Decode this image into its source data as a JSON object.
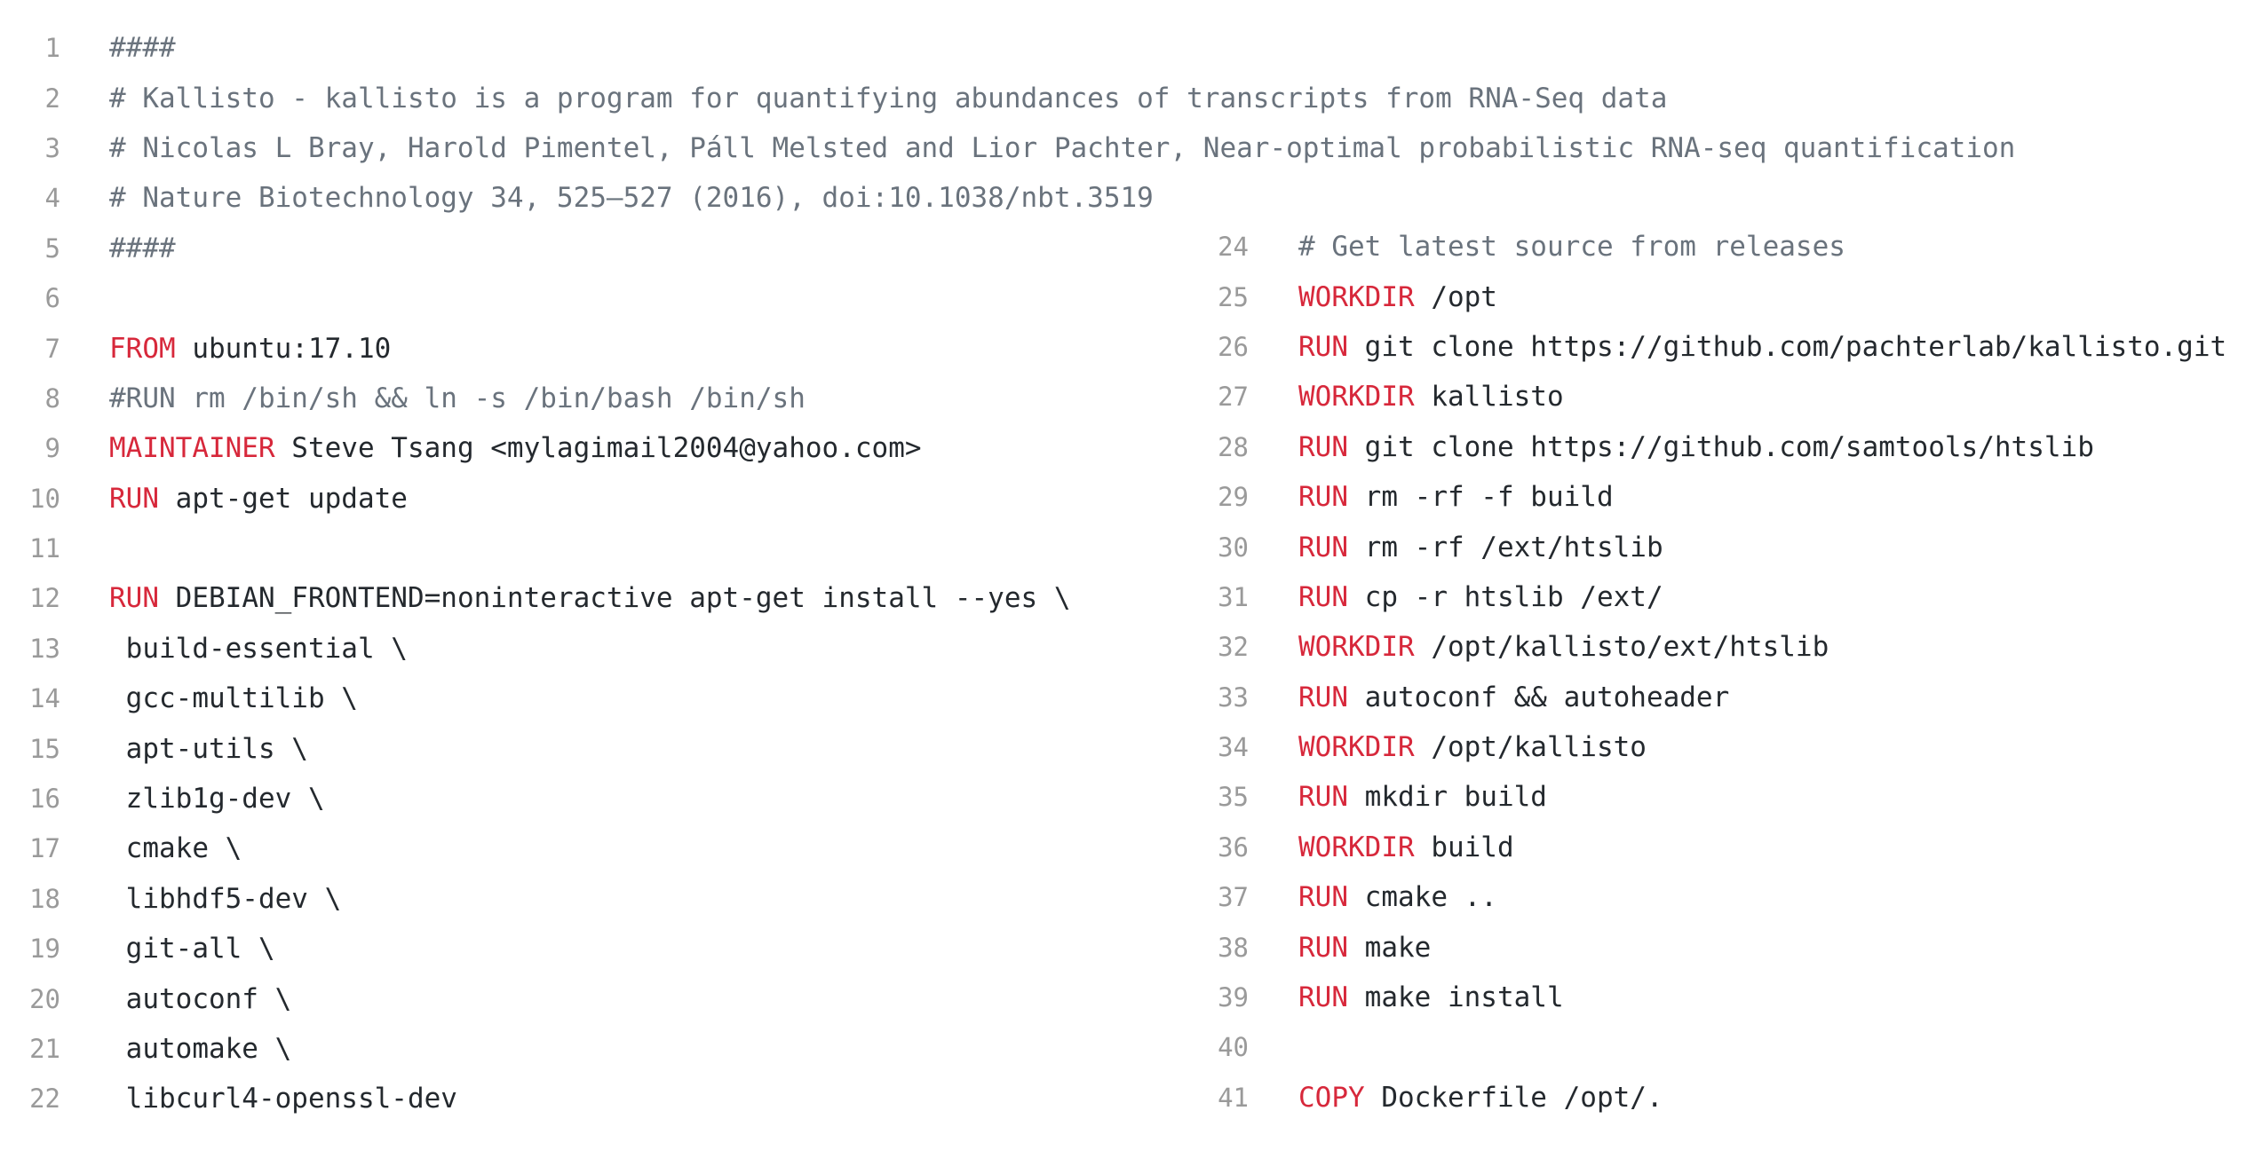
{
  "left_lines": [
    {
      "n": "1",
      "kw": "",
      "text": "####",
      "comment": true
    },
    {
      "n": "2",
      "kw": "",
      "text": "# Kallisto - kallisto is a program for quantifying abundances of transcripts from RNA-Seq data",
      "comment": true
    },
    {
      "n": "3",
      "kw": "",
      "text": "# Nicolas L Bray, Harold Pimentel, Páll Melsted and Lior Pachter, Near-optimal probabilistic RNA-seq quantification",
      "comment": true
    },
    {
      "n": "4",
      "kw": "",
      "text": "# Nature Biotechnology 34, 525–527 (2016), doi:10.1038/nbt.3519",
      "comment": true
    },
    {
      "n": "5",
      "kw": "",
      "text": "####",
      "comment": true
    },
    {
      "n": "6",
      "kw": "",
      "text": "",
      "comment": false
    },
    {
      "n": "7",
      "kw": "FROM",
      "text": " ubuntu:17.10",
      "comment": false
    },
    {
      "n": "8",
      "kw": "",
      "text": "#RUN rm /bin/sh && ln -s /bin/bash /bin/sh",
      "comment": true
    },
    {
      "n": "9",
      "kw": "MAINTAINER",
      "text": " Steve Tsang <mylagimail2004@yahoo.com>",
      "comment": false
    },
    {
      "n": "10",
      "kw": "RUN",
      "text": " apt-get update",
      "comment": false
    },
    {
      "n": "11",
      "kw": "",
      "text": "",
      "comment": false
    },
    {
      "n": "12",
      "kw": "RUN",
      "text": " DEBIAN_FRONTEND=noninteractive apt-get install --yes \\",
      "comment": false
    },
    {
      "n": "13",
      "kw": "",
      "text": " build-essential \\",
      "comment": false
    },
    {
      "n": "14",
      "kw": "",
      "text": " gcc-multilib \\",
      "comment": false
    },
    {
      "n": "15",
      "kw": "",
      "text": " apt-utils \\",
      "comment": false
    },
    {
      "n": "16",
      "kw": "",
      "text": " zlib1g-dev \\",
      "comment": false
    },
    {
      "n": "17",
      "kw": "",
      "text": " cmake \\",
      "comment": false
    },
    {
      "n": "18",
      "kw": "",
      "text": " libhdf5-dev \\",
      "comment": false
    },
    {
      "n": "19",
      "kw": "",
      "text": " git-all \\",
      "comment": false
    },
    {
      "n": "20",
      "kw": "",
      "text": " autoconf \\",
      "comment": false
    },
    {
      "n": "21",
      "kw": "",
      "text": " automake \\",
      "comment": false
    },
    {
      "n": "22",
      "kw": "",
      "text": " libcurl4-openssl-dev",
      "comment": false
    }
  ],
  "right_lines": [
    {
      "n": "24",
      "kw": "",
      "text": "# Get latest source from releases",
      "comment": true
    },
    {
      "n": "25",
      "kw": "WORKDIR",
      "text": " /opt",
      "comment": false
    },
    {
      "n": "26",
      "kw": "RUN",
      "text": " git clone https://github.com/pachterlab/kallisto.git",
      "comment": false
    },
    {
      "n": "27",
      "kw": "WORKDIR",
      "text": " kallisto",
      "comment": false
    },
    {
      "n": "28",
      "kw": "RUN",
      "text": " git clone https://github.com/samtools/htslib",
      "comment": false
    },
    {
      "n": "29",
      "kw": "RUN",
      "text": " rm -rf -f build",
      "comment": false
    },
    {
      "n": "30",
      "kw": "RUN",
      "text": " rm -rf /ext/htslib",
      "comment": false
    },
    {
      "n": "31",
      "kw": "RUN",
      "text": " cp -r htslib /ext/",
      "comment": false
    },
    {
      "n": "32",
      "kw": "WORKDIR",
      "text": " /opt/kallisto/ext/htslib",
      "comment": false
    },
    {
      "n": "33",
      "kw": "RUN",
      "text": " autoconf && autoheader",
      "comment": false
    },
    {
      "n": "34",
      "kw": "WORKDIR",
      "text": " /opt/kallisto",
      "comment": false
    },
    {
      "n": "35",
      "kw": "RUN",
      "text": " mkdir build",
      "comment": false
    },
    {
      "n": "36",
      "kw": "WORKDIR",
      "text": " build",
      "comment": false
    },
    {
      "n": "37",
      "kw": "RUN",
      "text": " cmake ..",
      "comment": false
    },
    {
      "n": "38",
      "kw": "RUN",
      "text": " make",
      "comment": false
    },
    {
      "n": "39",
      "kw": "RUN",
      "text": " make install",
      "comment": false
    },
    {
      "n": "40",
      "kw": "",
      "text": "",
      "comment": false
    },
    {
      "n": "41",
      "kw": "COPY",
      "text": " Dockerfile /opt/.",
      "comment": false
    }
  ],
  "colors": {
    "keyword": "#d7283b",
    "comment": "#6a737d",
    "text": "#24292e",
    "line_number": "#9a9a9a",
    "background": "#ffffff"
  }
}
